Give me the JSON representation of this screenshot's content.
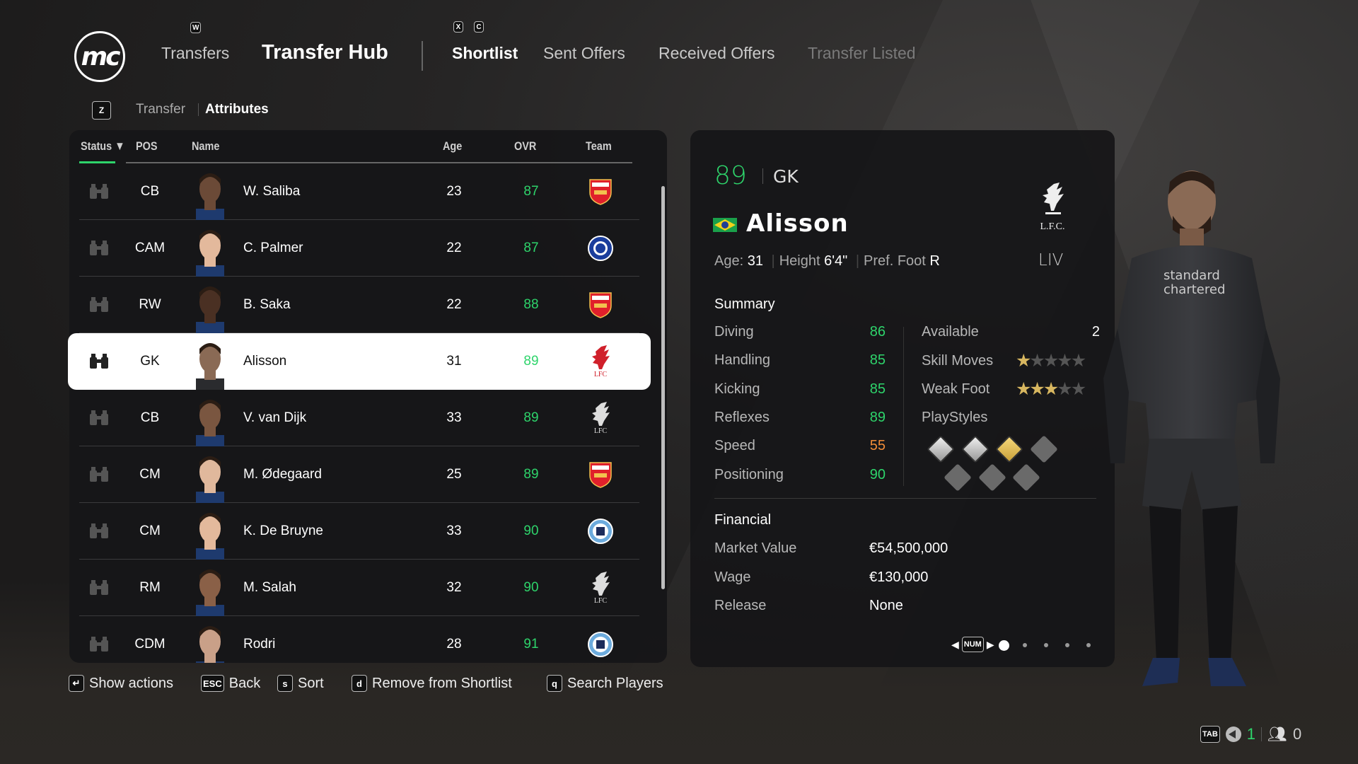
{
  "header": {
    "logo_text": "mc",
    "transfers": "Transfers",
    "title": "Transfer Hub",
    "tabs": [
      {
        "label": "Shortlist",
        "state": "active"
      },
      {
        "label": "Sent Offers"
      },
      {
        "label": "Received Offers"
      },
      {
        "label": "Transfer Listed",
        "state": "dimmed"
      }
    ],
    "keys": {
      "transfers": "W",
      "prev": "X",
      "next": "C",
      "subtab": "Z"
    }
  },
  "subtabs": [
    {
      "label": "Transfer"
    },
    {
      "label": "Attributes",
      "state": "active"
    }
  ],
  "table": {
    "columns": [
      "Status",
      "POS",
      "Name",
      "Age",
      "OVR",
      "Team"
    ],
    "sort_icon": "triangle-down-icon",
    "rows": [
      {
        "pos": "CB",
        "name": "W. Saliba",
        "age": "23",
        "ovr": "87",
        "team": "arsenal-crest-icon"
      },
      {
        "pos": "CAM",
        "name": "C. Palmer",
        "age": "22",
        "ovr": "87",
        "team": "chelsea-crest-icon"
      },
      {
        "pos": "RW",
        "name": "B. Saka",
        "age": "22",
        "ovr": "88",
        "team": "arsenal-crest-icon"
      },
      {
        "pos": "GK",
        "name": "Alisson",
        "age": "31",
        "ovr": "89",
        "team": "liverpool-crest-icon",
        "selected": true
      },
      {
        "pos": "CB",
        "name": "V. van Dijk",
        "age": "33",
        "ovr": "89",
        "team": "liverpool-crest-icon"
      },
      {
        "pos": "CM",
        "name": "M. Ødegaard",
        "age": "25",
        "ovr": "89",
        "team": "arsenal-crest-icon"
      },
      {
        "pos": "CM",
        "name": "K. De Bruyne",
        "age": "33",
        "ovr": "90",
        "team": "mancity-crest-icon"
      },
      {
        "pos": "RM",
        "name": "M. Salah",
        "age": "32",
        "ovr": "90",
        "team": "liverpool-crest-icon"
      },
      {
        "pos": "CDM",
        "name": "Rodri",
        "age": "28",
        "ovr": "91",
        "team": "mancity-crest-icon"
      }
    ]
  },
  "detail": {
    "ovr": "89",
    "position": "GK",
    "name": "Alisson",
    "nation_flag": "brazil-flag-icon",
    "club_crest": "liverpool-crest-icon",
    "club_crest_text": "L.F.C.",
    "club_code": "LIV",
    "age_label": "Age:",
    "age": "31",
    "height_label": "Height",
    "height": "6'4\"",
    "foot_label": "Pref. Foot",
    "foot": "R",
    "summary_title": "Summary",
    "stats": [
      {
        "label": "Diving",
        "value": "86",
        "color": "#2ed46b"
      },
      {
        "label": "Handling",
        "value": "85",
        "color": "#2ed46b"
      },
      {
        "label": "Kicking",
        "value": "85",
        "color": "#2ed46b"
      },
      {
        "label": "Reflexes",
        "value": "89",
        "color": "#2ed46b"
      },
      {
        "label": "Speed",
        "value": "55",
        "color": "#f08c38"
      },
      {
        "label": "Positioning",
        "value": "90",
        "color": "#2ed46b"
      }
    ],
    "available_label": "Available",
    "available": "2",
    "skill_label": "Skill Moves",
    "skill_moves": 1,
    "weak_label": "Weak Foot",
    "weak_foot": 3,
    "stars_max": 5,
    "playstyles_label": "PlayStyles",
    "playstyles": [
      "playstyle-silver-icon",
      "playstyle-silver-icon",
      "playstyle-gold-icon",
      "empty",
      "empty",
      "empty",
      "empty"
    ],
    "financial_title": "Financial",
    "financial": [
      {
        "label": "Market Value",
        "value": "€54,500,000"
      },
      {
        "label": "Wage",
        "value": "€130,000"
      },
      {
        "label": "Release",
        "value": "None"
      }
    ],
    "pager": {
      "key": "NUM",
      "pages": 5,
      "current": 1
    }
  },
  "footer": [
    {
      "key": "↵",
      "label": "Show actions"
    },
    {
      "key": "ESC",
      "label": "Back"
    },
    {
      "key": "s",
      "label": "Sort"
    },
    {
      "key": "d",
      "label": "Remove from Shortlist"
    },
    {
      "key": "q",
      "label": "Search Players"
    }
  ],
  "status_bar": {
    "key": "TAB",
    "count_1": "1",
    "count_2": "0"
  },
  "colors": {
    "green": "#2ed46b",
    "orange": "#f08c38",
    "star_gold": "#d8b760"
  }
}
